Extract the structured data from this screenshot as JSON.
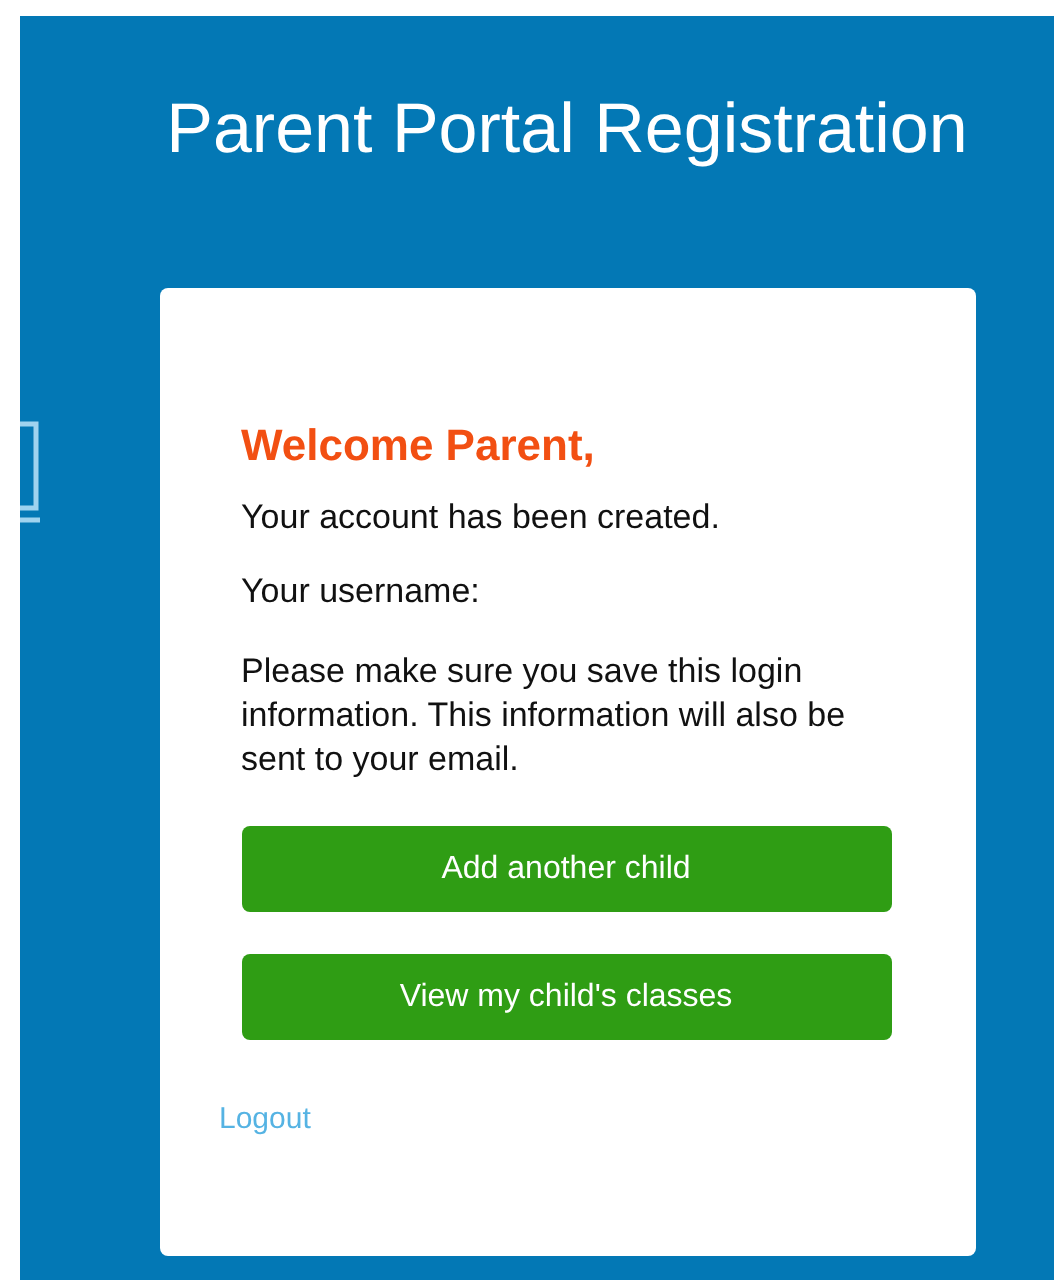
{
  "header": {
    "title": "Parent Portal Registration"
  },
  "card": {
    "heading": "Welcome Parent,",
    "message": "Your account has been created.",
    "username_label": "Your username:",
    "notice": "Please make sure you save this login information. This information will also be sent to your email.",
    "buttons": [
      {
        "label": "Add another child"
      },
      {
        "label": "View my child's classes"
      }
    ],
    "link": "Logout"
  }
}
